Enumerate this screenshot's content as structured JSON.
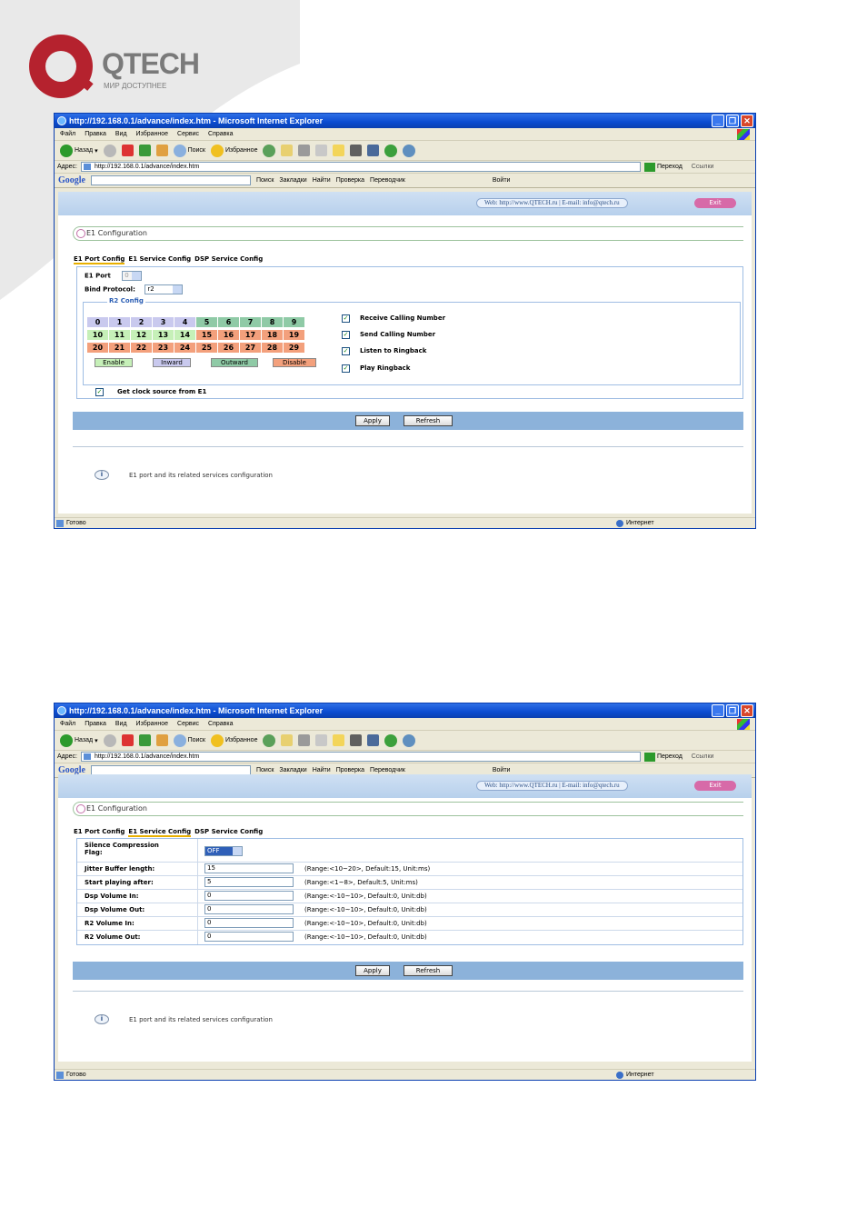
{
  "logo": {
    "brand": "QTECH",
    "tagline": "МИР ДОСТУПНЕЕ"
  },
  "browser": {
    "title": "http://192.168.0.1/advance/index.htm - Microsoft Internet Explorer",
    "window_buttons": [
      "_",
      "❐",
      "✕"
    ],
    "menu": [
      "Файл",
      "Правка",
      "Вид",
      "Избранное",
      "Сервис",
      "Справка"
    ],
    "toolbar": {
      "back": "Назад",
      "search": "Поиск",
      "favorites": "Избранное"
    },
    "address_label": "Адрес:",
    "address": "http://192.168.0.1/advance/index.htm",
    "go": "Переход",
    "links": "Ссылки",
    "google": {
      "logo": "Google",
      "search": "Поиск",
      "bookmarks": "Закладки",
      "find": "Найти",
      "check": "Проверка",
      "translate": "Переводчик",
      "login": "Войти"
    },
    "status": "Готово",
    "zone": "Интернет"
  },
  "header": {
    "web": "Web: http://www.QTECH.ru",
    "email": "E-mail: info@qtech.ru",
    "exit": "Exit"
  },
  "config": {
    "title": "E1 Configuration",
    "tabs": [
      "E1 Port Config",
      "E1 Service Config",
      "DSP Service Config"
    ]
  },
  "port_config": {
    "e1_port_label": "E1 Port",
    "e1_port_value": "0",
    "bind_protocol_label": "Bind Protocol:",
    "bind_protocol_value": "r2",
    "r2_legend": "R2 Config",
    "channels": [
      "0",
      "1",
      "2",
      "3",
      "4",
      "5",
      "6",
      "7",
      "8",
      "9",
      "10",
      "11",
      "12",
      "13",
      "14",
      "15",
      "16",
      "17",
      "18",
      "19",
      "20",
      "21",
      "22",
      "23",
      "24",
      "25",
      "26",
      "27",
      "28",
      "29"
    ],
    "buttons": [
      "Enable",
      "Inward",
      "Outward",
      "Disable"
    ],
    "options": [
      {
        "label": "Receive Calling Number",
        "checked": true
      },
      {
        "label": "Send Calling Number",
        "checked": true
      },
      {
        "label": "Listen to Ringback",
        "checked": true
      },
      {
        "label": "Play Ringback",
        "checked": true
      }
    ],
    "clock_label": "Get clock source from E1",
    "clock_checked": true,
    "check_mark": "✓"
  },
  "service_config": {
    "silence_label_1": "Silence Compression",
    "silence_label_2": "Flag:",
    "silence_value": "OFF",
    "fields": [
      {
        "label": "Jitter Buffer length:",
        "value": "15",
        "hint": "(Range:<10~20>, Default:15, Unit:ms)"
      },
      {
        "label": "Start playing after:",
        "value": "5",
        "hint": "(Range:<1~8>, Default:5, Unit:ms)"
      },
      {
        "label": "Dsp Volume In:",
        "value": "0",
        "hint": "(Range:<-10~10>, Default:0, Unit:db)"
      },
      {
        "label": "Dsp Volume Out:",
        "value": "0",
        "hint": "(Range:<-10~10>, Default:0, Unit:db)"
      },
      {
        "label": "R2 Volume In:",
        "value": "0",
        "hint": "(Range:<-10~10>, Default:0, Unit:db)"
      },
      {
        "label": "R2 Volume Out:",
        "value": "0",
        "hint": "(Range:<-10~10>, Default:0, Unit:db)"
      }
    ]
  },
  "actions": {
    "apply": "Apply",
    "refresh": "Refresh"
  },
  "info": {
    "icon": "i",
    "text": "E1 port and its related services configuration"
  },
  "colors": {
    "titlebar": "#0a4bd0",
    "header_band": "#b7d0ec",
    "action_bar": "#8cb2da",
    "exit": "#d76aa8"
  }
}
